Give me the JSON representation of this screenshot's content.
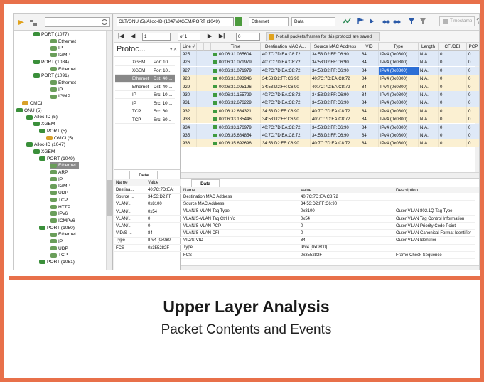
{
  "caption": {
    "title": "Upper Layer Analysis",
    "subtitle": "Packet Contents and Events"
  },
  "toolbar": {
    "path": "OLT/ONU (5)/Alloc-ID (1047)/XGEM/PORT (1049)",
    "protocol_filter": "Ethernet",
    "view_filter": "Data",
    "timestamp_label": "Timestamp",
    "icons": [
      "equalizer-icon",
      "flag-icon",
      "play-icon",
      "binoculars-icon",
      "binoculars-next-icon",
      "filter-icon",
      "filter-clear-icon",
      "timestamp-icon",
      "help-icon"
    ]
  },
  "navigation": {
    "page_value": "1",
    "page_of": "of 1",
    "search_value": "0",
    "warning": "Not all packets/frames for this protocol are saved"
  },
  "tree": {
    "items": [
      "PORT (1077)",
      "Ethernet",
      "IP",
      "IGMP",
      "PORT (1084)",
      "Ethernet",
      "PORT (1091)",
      "Ethernet",
      "IP",
      "IGMP",
      "OMCI",
      "ONU (5)",
      "Alloc-ID (5)",
      "XGEM",
      "PORT (5)",
      "OMCI (5)",
      "Alloc-ID (1047)",
      "XGEM",
      "PORT (1049)",
      "Ethernet",
      "ARP",
      "IP",
      "IGMP",
      "UDP",
      "TCP",
      "HTTP",
      "IPv6",
      "ICMPv6",
      "PORT (1050)",
      "Ethernet",
      "IP",
      "UDP",
      "TCP",
      "PORT (1051)"
    ],
    "selected_item": "Ethernet"
  },
  "protocol_panel": {
    "title": "Protoc...",
    "rows": [
      {
        "proto": "XGEM",
        "info": "Port 10..."
      },
      {
        "proto": "XGEM",
        "info": "Port 10..."
      },
      {
        "proto": "Ethernet",
        "info": "Dst: 40:..."
      },
      {
        "proto": "Ethernet",
        "info": "Dst: 40:..."
      },
      {
        "proto": "IP",
        "info": "Src: 10...."
      },
      {
        "proto": "IP",
        "info": "Src: 10...."
      },
      {
        "proto": "TCP",
        "info": "Src: 60..."
      },
      {
        "proto": "TCP",
        "info": "Src: 60..."
      }
    ],
    "selected_index": 2
  },
  "packet_table": {
    "columns": [
      "Line #",
      "",
      "",
      "Time",
      "Destination MAC A...",
      "Source MAC Address",
      "VID",
      "Type",
      "Length",
      "CFI/DEI",
      "PCP"
    ],
    "rows": [
      {
        "line": "925",
        "time": "00:06:31.065604",
        "dst": "40:7C:7D:EA:C8:72",
        "src": "34:53:D2:FF:C6:90",
        "vid": "84",
        "type": "IPv4 (0x0800)",
        "length": "N.A.",
        "cfi": "0",
        "pcp": "0"
      },
      {
        "line": "926",
        "time": "00:06:31.071979",
        "dst": "40:7C:7D:EA:C8:72",
        "src": "34:53:D2:FF:C6:90",
        "vid": "84",
        "type": "IPv4 (0x0800)",
        "length": "N.A.",
        "cfi": "0",
        "pcp": "0"
      },
      {
        "line": "927",
        "time": "00:06:31.071979",
        "dst": "40:7C:7D:EA:C8:72",
        "src": "34:53:D2:FF:C6:90",
        "vid": "84",
        "type": "IPv4 (0x0800)",
        "length": "N.A.",
        "cfi": "0",
        "pcp": "0"
      },
      {
        "line": "928",
        "time": "00:06:31.093946",
        "dst": "34:53:D2:FF:C6:90",
        "src": "40:7C:7D:EA:C8:72",
        "vid": "84",
        "type": "IPv4 (0x0800)",
        "length": "N.A.",
        "cfi": "0",
        "pcp": "0"
      },
      {
        "line": "929",
        "time": "00:06:31.095196",
        "dst": "34:53:D2:FF:C6:90",
        "src": "40:7C:7D:EA:C8:72",
        "vid": "84",
        "type": "IPv4 (0x0800)",
        "length": "N.A.",
        "cfi": "0",
        "pcp": "0"
      },
      {
        "line": "930",
        "time": "00:06:31.155729",
        "dst": "40:7C:7D:EA:C8:72",
        "src": "34:53:D2:FF:C6:90",
        "vid": "84",
        "type": "IPv4 (0x0800)",
        "length": "N.A.",
        "cfi": "0",
        "pcp": "0"
      },
      {
        "line": "931",
        "time": "00:06:32.676229",
        "dst": "40:7C:7D:EA:C8:72",
        "src": "34:53:D2:FF:C6:90",
        "vid": "84",
        "type": "IPv4 (0x0800)",
        "length": "N.A.",
        "cfi": "0",
        "pcp": "0"
      },
      {
        "line": "932",
        "time": "00:06:32.684321",
        "dst": "34:53:D2:FF:C6:90",
        "src": "40:7C:7D:EA:C8:72",
        "vid": "84",
        "type": "IPv4 (0x0800)",
        "length": "N.A.",
        "cfi": "0",
        "pcp": "0"
      },
      {
        "line": "933",
        "time": "00:06:33.135446",
        "dst": "34:53:D2:FF:C6:90",
        "src": "40:7C:7D:EA:C8:72",
        "vid": "84",
        "type": "IPv4 (0x0800)",
        "length": "N.A.",
        "cfi": "0",
        "pcp": "0"
      },
      {
        "line": "934",
        "time": "00:06:33.176979",
        "dst": "40:7C:7D:EA:C8:72",
        "src": "34:53:D2:FF:C6:90",
        "vid": "84",
        "type": "IPv4 (0x0800)",
        "length": "N.A.",
        "cfi": "0",
        "pcp": "0"
      },
      {
        "line": "935",
        "time": "00:06:35.684854",
        "dst": "40:7C:7D:EA:C8:72",
        "src": "34:53:D2:FF:C6:90",
        "vid": "84",
        "type": "IPv4 (0x0800)",
        "length": "N.A.",
        "cfi": "0",
        "pcp": "0"
      },
      {
        "line": "936",
        "time": "00:06:35.692696",
        "dst": "34:53:D2:FF:C6:90",
        "src": "40:7C:7D:EA:C8:72",
        "vid": "84",
        "type": "IPv4 (0x0800)",
        "length": "N.A.",
        "cfi": "0",
        "pcp": "0"
      }
    ],
    "highlighted_line": "927",
    "row_colors": {
      "outbound": "#dfe9f7",
      "inbound": "#fbf0d2",
      "highlight": "#2c6fd6"
    }
  },
  "data_small": {
    "tab": "Data",
    "headers": [
      "Name",
      "Value"
    ],
    "rows": [
      {
        "name": "Destina...",
        "value": "40:7C:7D:EA:"
      },
      {
        "name": "Source ...",
        "value": "34:53:D2:FF"
      },
      {
        "name": "VLAN/...",
        "value": "0x8100"
      },
      {
        "name": "VLAN/...",
        "value": "0x54"
      },
      {
        "name": "VLAN/...",
        "value": "0"
      },
      {
        "name": "VLAN/...",
        "value": "0"
      },
      {
        "name": "VID/S-...",
        "value": "84"
      },
      {
        "name": "Type",
        "value": "IPv4 (0x080"
      },
      {
        "name": "FCS",
        "value": "0x355282F"
      }
    ]
  },
  "data_big": {
    "tab": "Data",
    "headers": [
      "Name",
      "Value",
      "Description"
    ],
    "rows": [
      {
        "name": "Destination MAC Address",
        "value": "40:7C:7D:EA:C8:72",
        "desc": ""
      },
      {
        "name": "Source MAC Address",
        "value": "34:53:D2:FF:C6:90",
        "desc": ""
      },
      {
        "name": "VLAN/S-VLAN Tag Type",
        "value": "0x8100",
        "desc": "Outer VLAN 802.1Q Tag Type"
      },
      {
        "name": "VLAN/S-VLAN Tag Ctrl Info",
        "value": "0x54",
        "desc": "Outer VLAN Tag Control Information"
      },
      {
        "name": "VLAN/S-VLAN PCP",
        "value": "0",
        "desc": "Outer VLAN Priority Code Point"
      },
      {
        "name": "VLAN/S-VLAN CFI",
        "value": "0",
        "desc": "Outer VLAN Canonical Format Identifier"
      },
      {
        "name": "VID/S-VID",
        "value": "84",
        "desc": "Outer VLAN Identifier"
      },
      {
        "name": "Type",
        "value": "IPv4 (0x0800)",
        "desc": ""
      },
      {
        "name": "FCS",
        "value": "0x355282F",
        "desc": "Frame Check Sequence"
      }
    ]
  },
  "colors": {
    "accent": "#e8704a",
    "tree_port": "#3a8f3a",
    "tree_node": "#3b8d3b",
    "selection": "#888888"
  }
}
